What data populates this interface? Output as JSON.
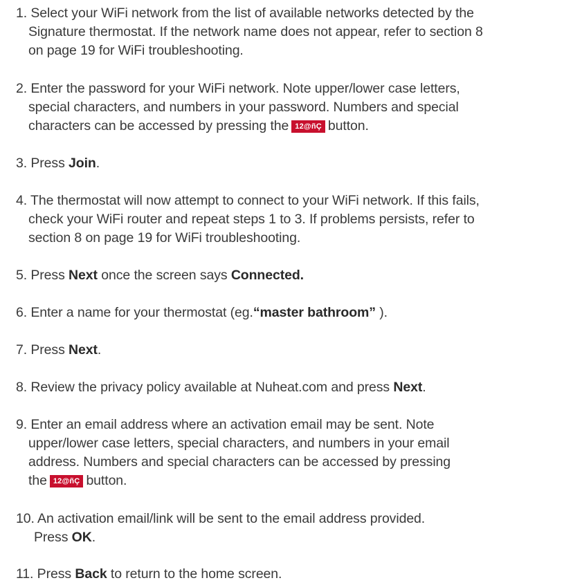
{
  "button_badge": "12@ñÇ",
  "steps": {
    "s1": {
      "l1": "1. Select your WiFi network from the list of available networks detected by the",
      "l2": "Signature thermostat. If the network name does not appear, refer to section 8",
      "l3": "on page 19 for WiFi troubleshooting."
    },
    "s2": {
      "l1": "2. Enter the password for your WiFi network. Note upper/lower case letters,",
      "l2": "special characters, and numbers in your password. Numbers and special",
      "l3a": "characters can be accessed by pressing the",
      "l3b": "button."
    },
    "s3": {
      "pre": "3. Press ",
      "bold": "Join",
      "post": "."
    },
    "s4": {
      "l1": "4. The thermostat will now attempt to connect to your WiFi network. If this fails,",
      "l2": "check your WiFi router and repeat steps 1 to 3. If problems persists, refer to",
      "l3": "section 8 on page 19 for WiFi troubleshooting."
    },
    "s5": {
      "pre": "5. Press ",
      "bold1": "Next",
      "mid": " once the screen says ",
      "bold2": "Connected."
    },
    "s6": {
      "pre": "6. Enter a name for your thermostat (eg.",
      "bold": "“master bathroom”",
      "post": " )."
    },
    "s7": {
      "pre": "7. Press ",
      "bold": "Next",
      "post": "."
    },
    "s8": {
      "pre": "8. Review the privacy policy available at Nuheat.com and press ",
      "bold": "Next",
      "post": "."
    },
    "s9": {
      "l1": "9. Enter an email address where an activation email may be sent. Note",
      "l2": "upper/lower case letters, special characters, and numbers in your email",
      "l3": "address. Numbers and special characters can be accessed by pressing",
      "l4a": "the",
      "l4b": "button."
    },
    "s10": {
      "l1": "10. An activation email/link will be sent to the email address provided.",
      "l2pre": "Press ",
      "l2bold": "OK",
      "l2post": "."
    },
    "s11": {
      "pre": "11. Press ",
      "bold": "Back",
      "post": "  to return to the home screen."
    }
  }
}
